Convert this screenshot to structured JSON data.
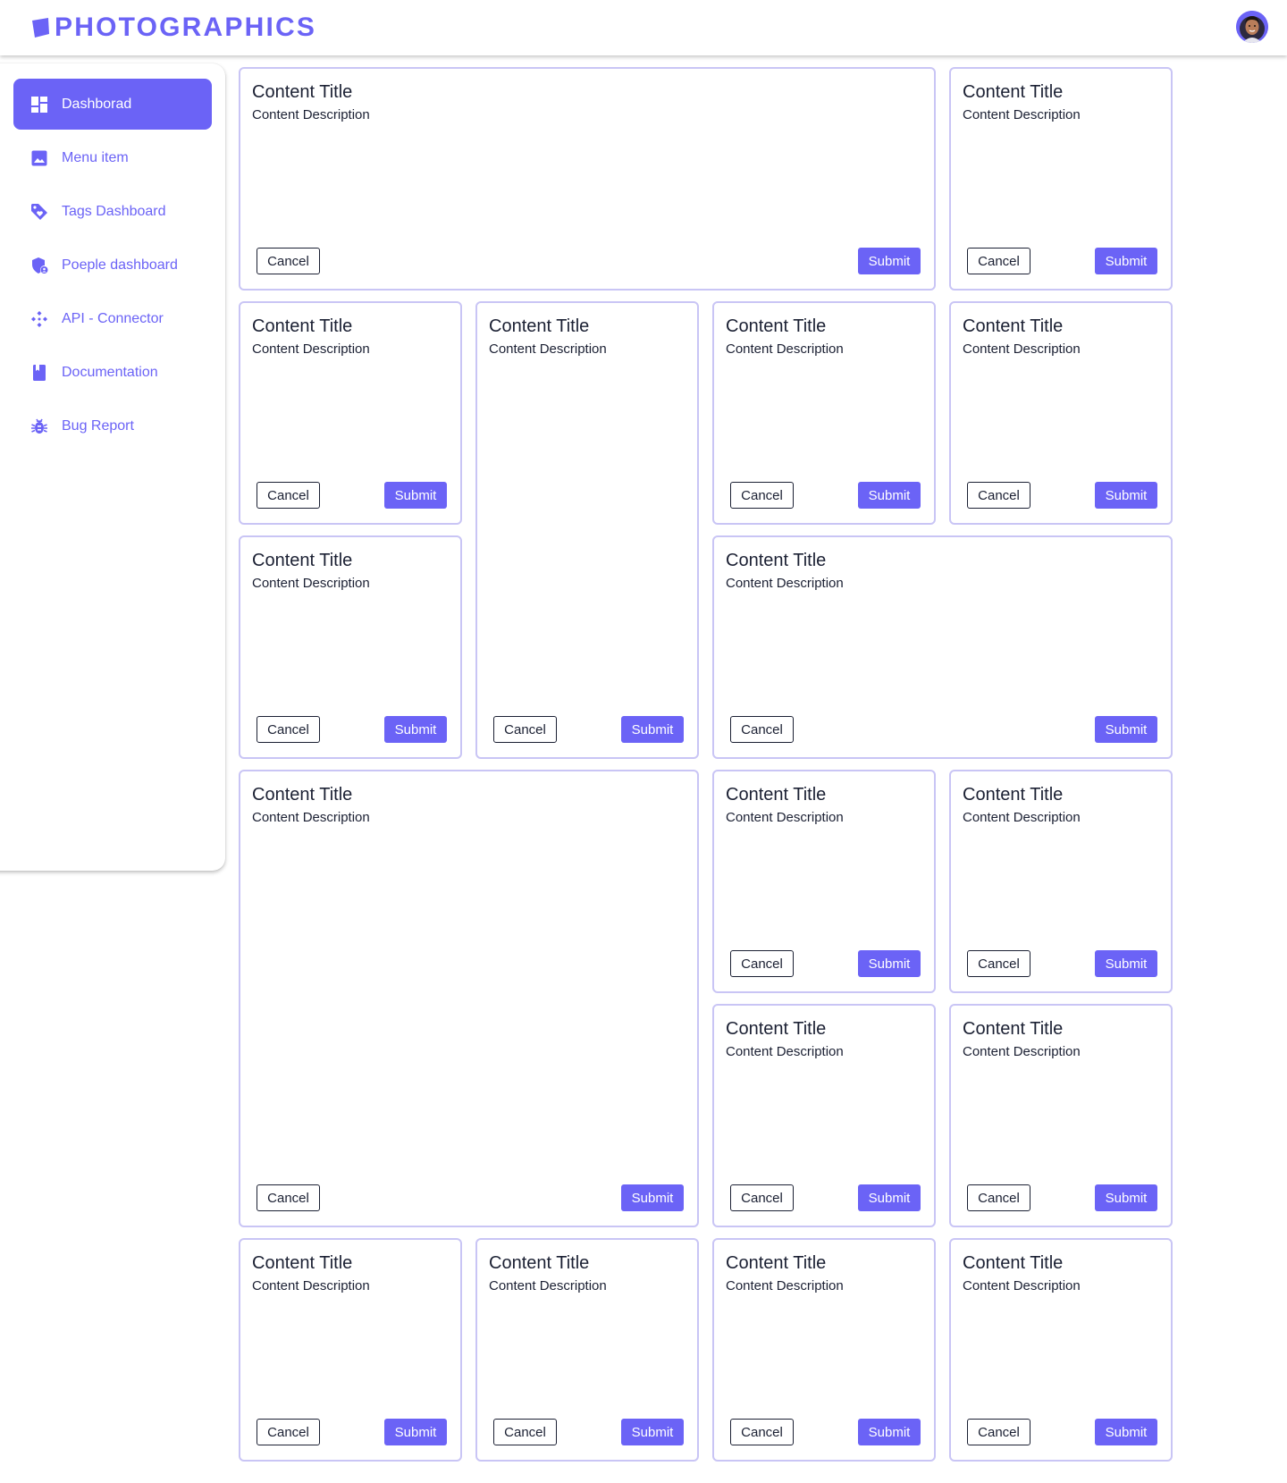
{
  "brand": {
    "name": "PHOTOGRAPHICS",
    "accent_color": "#6b63f6"
  },
  "header": {
    "avatar_icon": "user-avatar"
  },
  "sidebar": {
    "items": [
      {
        "label": "Dashborad",
        "icon": "dashboard-icon",
        "active": true
      },
      {
        "label": "Menu item",
        "icon": "image-icon",
        "active": false
      },
      {
        "label": "Tags Dashboard",
        "icon": "tag-icon",
        "active": false
      },
      {
        "label": "Poeple dashboard",
        "icon": "people-shield-icon",
        "active": false
      },
      {
        "label": "API - Connector",
        "icon": "connector-icon",
        "active": false
      },
      {
        "label": "Documentation",
        "icon": "book-icon",
        "active": false
      },
      {
        "label": "Bug Report",
        "icon": "bug-icon",
        "active": false
      }
    ]
  },
  "cards": [
    {
      "title": "Content Title",
      "description": "Content Description",
      "cancel_label": "Cancel",
      "submit_label": "Submit"
    },
    {
      "title": "Content Title",
      "description": "Content Description",
      "cancel_label": "Cancel",
      "submit_label": "Submit"
    },
    {
      "title": "Content Title",
      "description": "Content Description",
      "cancel_label": "Cancel",
      "submit_label": "Submit"
    },
    {
      "title": "Content Title",
      "description": "Content Description",
      "cancel_label": "Cancel",
      "submit_label": "Submit"
    },
    {
      "title": "Content Title",
      "description": "Content Description",
      "cancel_label": "Cancel",
      "submit_label": "Submit"
    },
    {
      "title": "Content Title",
      "description": "Content Description",
      "cancel_label": "Cancel",
      "submit_label": "Submit"
    },
    {
      "title": "Content Title",
      "description": "Content Description",
      "cancel_label": "Cancel",
      "submit_label": "Submit"
    },
    {
      "title": "Content Title",
      "description": "Content Description",
      "cancel_label": "Cancel",
      "submit_label": "Submit"
    },
    {
      "title": "Content Title",
      "description": "Content Description",
      "cancel_label": "Cancel",
      "submit_label": "Submit"
    },
    {
      "title": "Content Title",
      "description": "Content Description",
      "cancel_label": "Cancel",
      "submit_label": "Submit"
    },
    {
      "title": "Content Title",
      "description": "Content Description",
      "cancel_label": "Cancel",
      "submit_label": "Submit"
    },
    {
      "title": "Content Title",
      "description": "Content Description",
      "cancel_label": "Cancel",
      "submit_label": "Submit"
    },
    {
      "title": "Content Title",
      "description": "Content Description",
      "cancel_label": "Cancel",
      "submit_label": "Submit"
    },
    {
      "title": "Content Title",
      "description": "Content Description",
      "cancel_label": "Cancel",
      "submit_label": "Submit"
    },
    {
      "title": "Content Title",
      "description": "Content Description",
      "cancel_label": "Cancel",
      "submit_label": "Submit"
    },
    {
      "title": "Content Title",
      "description": "Content Description",
      "cancel_label": "Cancel",
      "submit_label": "Submit"
    },
    {
      "title": "Content Title",
      "description": "Content Description",
      "cancel_label": "Cancel",
      "submit_label": "Submit"
    },
    {
      "title": "Content Title",
      "description": "Content Description",
      "cancel_label": "Cancel",
      "submit_label": "Submit"
    }
  ]
}
